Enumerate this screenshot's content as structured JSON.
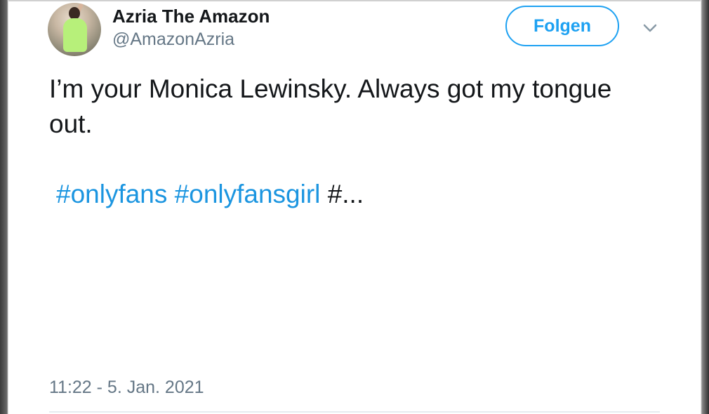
{
  "tweet": {
    "author_name": "Azria The Amazon",
    "author_handle": "@AmazonAzria",
    "follow_label": "Folgen",
    "text": "I’m your Monica Lewinsky. Always got my tongue out.",
    "hashtags": [
      "#onlyfans",
      "#onlyfansgirl"
    ],
    "truncated_tail": "#...",
    "timestamp": "11:22 - 5. Jan. 2021"
  },
  "icons": {
    "menu": "chevron-down-icon",
    "avatar": "profile-avatar"
  },
  "colors": {
    "accent": "#1da1f2",
    "hashtag": "#1b95e0",
    "secondary_text": "#657786",
    "primary_text": "#14171a"
  }
}
